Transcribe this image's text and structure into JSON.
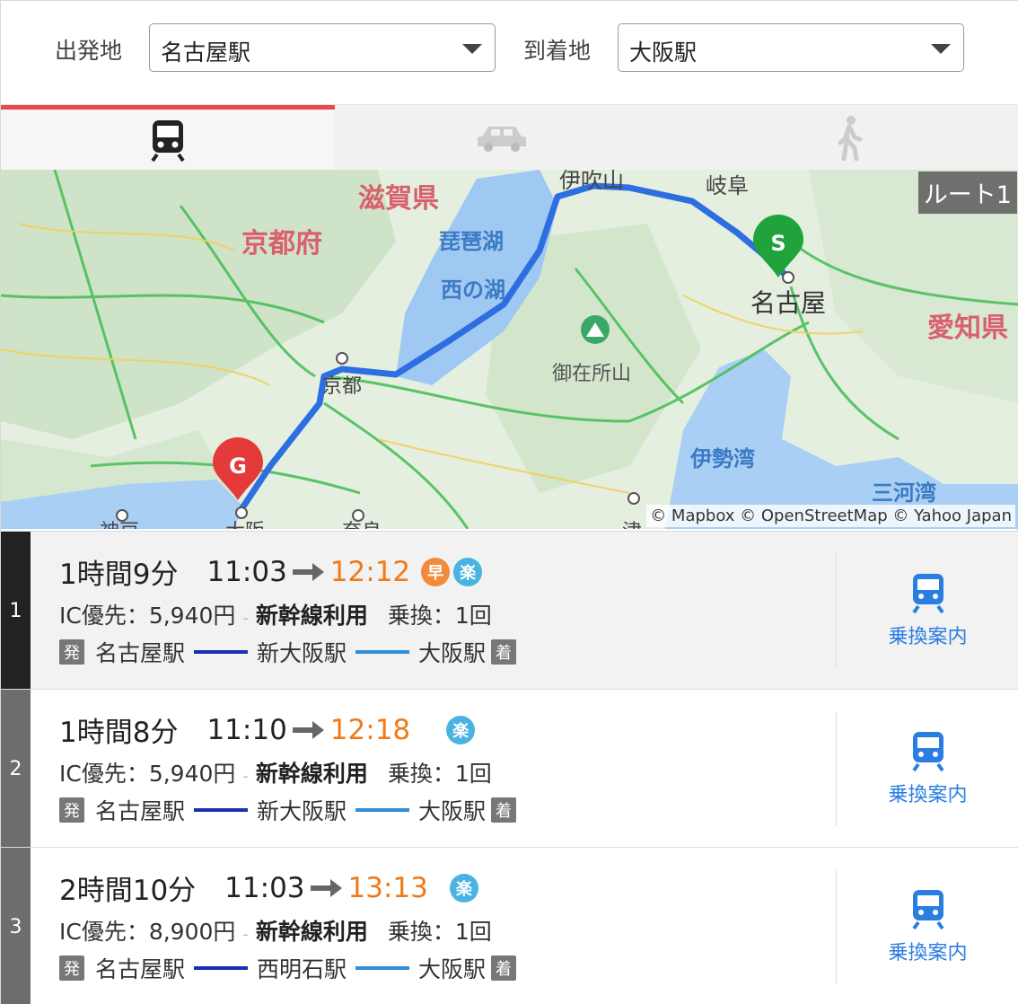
{
  "search": {
    "from_label": "出発地",
    "from_value": "名古屋駅",
    "to_label": "到着地",
    "to_value": "大阪駅"
  },
  "tabs": [
    {
      "icon": "train-icon",
      "active": true
    },
    {
      "icon": "car-icon",
      "active": false
    },
    {
      "icon": "walk-icon",
      "active": false
    }
  ],
  "map": {
    "route_badge": "ルート1",
    "attribution": "© Mapbox © OpenStreetMap © Yahoo Japan",
    "labels": {
      "shiga": "滋賀県",
      "kyoto_pref": "京都府",
      "biwako": "琵琶湖",
      "nishinoko": "西の湖",
      "ibuki": "伊吹山",
      "gifu": "岐阜",
      "nagoya": "名古屋",
      "aichi": "愛知県",
      "gozaisho": "御在所山",
      "kyoto": "京都",
      "ise_bay": "伊勢湾",
      "mikawa_bay": "三河湾",
      "kobe": "神戸",
      "osaka": "大阪",
      "nara": "奈良",
      "tsu": "津"
    },
    "start_marker": "S",
    "goal_marker": "G",
    "colors": {
      "route": "#2d6fe0",
      "start": "#1fa33a",
      "goal": "#e53a3a"
    }
  },
  "routes": [
    {
      "num": "1",
      "duration": "1時間9分",
      "dep": "11:03",
      "arr": "12:12",
      "badges": [
        "早",
        "楽"
      ],
      "fare": "IC優先：5,940円",
      "sep": "-",
      "shinkansen": "新幹線利用",
      "transfer": "乗換：1回",
      "dep_mark": "発",
      "stations": [
        "名古屋駅",
        "新大阪駅",
        "大阪駅"
      ],
      "arr_mark": "着",
      "transfer_label": "乗換案内"
    },
    {
      "num": "2",
      "duration": "1時間8分",
      "dep": "11:10",
      "arr": "12:18",
      "badges": [
        "楽"
      ],
      "fare": "IC優先：5,940円",
      "sep": "-",
      "shinkansen": "新幹線利用",
      "transfer": "乗換：1回",
      "dep_mark": "発",
      "stations": [
        "名古屋駅",
        "新大阪駅",
        "大阪駅"
      ],
      "arr_mark": "着",
      "transfer_label": "乗換案内"
    },
    {
      "num": "3",
      "duration": "2時間10分",
      "dep": "11:03",
      "arr": "13:13",
      "badges": [
        "楽"
      ],
      "fare": "IC優先：8,900円",
      "sep": "-",
      "shinkansen": "新幹線利用",
      "transfer": "乗換：1回",
      "dep_mark": "発",
      "stations": [
        "名古屋駅",
        "西明石駅",
        "大阪駅"
      ],
      "arr_mark": "着",
      "transfer_label": "乗換案内"
    }
  ]
}
